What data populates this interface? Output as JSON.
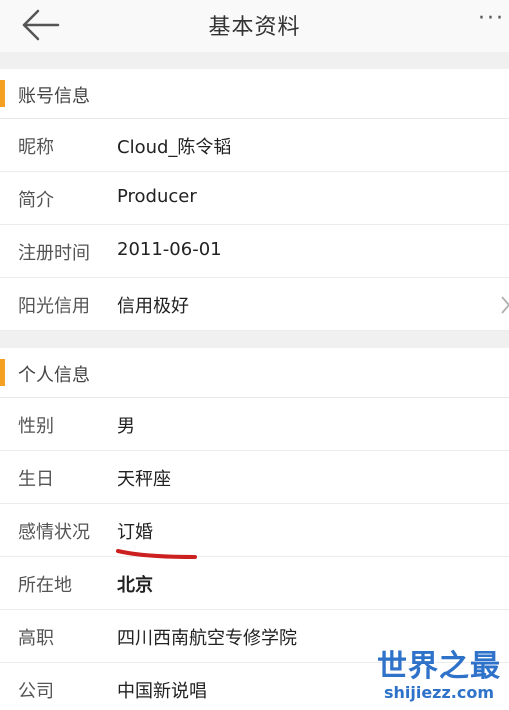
{
  "header": {
    "title": "基本资料",
    "more_label": "···"
  },
  "account_section": {
    "title": "账号信息",
    "rows": [
      {
        "label": "昵称",
        "value": "Cloud_陈令韬"
      },
      {
        "label": "简介",
        "value": "Producer"
      },
      {
        "label": "注册时间",
        "value": "2011-06-01"
      },
      {
        "label": "阳光信用",
        "value": "信用极好"
      }
    ]
  },
  "personal_section": {
    "title": "个人信息",
    "rows": [
      {
        "label": "性别",
        "value": "男"
      },
      {
        "label": "生日",
        "value": "天秤座"
      },
      {
        "label": "感情状况",
        "value": "订婚"
      },
      {
        "label": "所在地",
        "value": "北京"
      },
      {
        "label": "高职",
        "value": "四川西南航空专修学院"
      },
      {
        "label": "公司",
        "value": "中国新说唱"
      }
    ]
  },
  "watermark": {
    "text": "世界之最",
    "domain": "shijiezz.com"
  },
  "colors": {
    "accent": "#f5a020",
    "annotation": "#cc1f1f",
    "watermark": "#2f72c9",
    "background": "#f0f0f0"
  },
  "icons": {
    "back": "arrow-left-icon",
    "more": "more-horizontal-icon",
    "chevron": "chevron-right-icon"
  }
}
